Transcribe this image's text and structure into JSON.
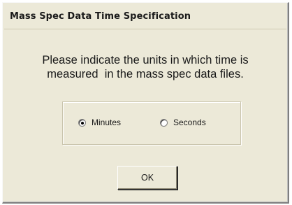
{
  "window": {
    "title": "Mass Spec Data Time Specification"
  },
  "message": {
    "line1": "Please indicate the units in which time is",
    "line2": "measured  in the mass spec data files."
  },
  "units": {
    "options": [
      {
        "label": "Minutes",
        "selected": true
      },
      {
        "label": "Seconds",
        "selected": false
      }
    ],
    "selected": "Minutes"
  },
  "buttons": {
    "ok_label": "OK"
  }
}
